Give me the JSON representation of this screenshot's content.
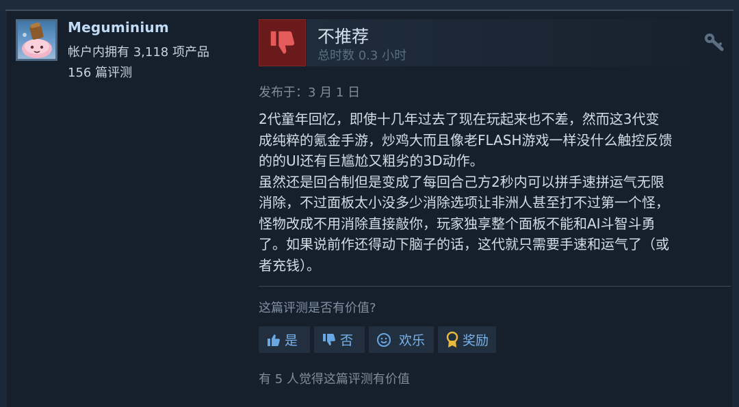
{
  "author": {
    "name": "Meguminium",
    "products_owned": "帐户内拥有 3,118 项产品",
    "reviews_count": "156 篇评测"
  },
  "review": {
    "verdict": "不推荐",
    "hours": "总时数 0.3 小时",
    "posted": "发布于：3 月 1 日",
    "paragraphs": [
      "2代童年回忆，即使十几年过去了现在玩起来也不差，然而这3代变",
      "成纯粹的氪金手游，炒鸡大而且像老FLASH游戏一样没什么触控反馈",
      "的的UI还有巨尴尬又粗劣的3D动作。",
      "虽然还是回合制但是变成了每回合己方2秒内可以拼手速拼运气无限",
      "消除，不过面板太小没多少消除选项让非洲人甚至打不过第一个怪，",
      "怪物改成不用消除直接敲你，玩家独享整个面板不能和AI斗智斗勇",
      "了。如果说前作还得动下脑子的话，这代就只需要手速和运气了（或",
      "者充钱）。"
    ]
  },
  "feedback": {
    "question": "这篇评测是否有价值?",
    "yes": "是",
    "no": "否",
    "funny": "欢乐",
    "award": "奖励",
    "helpful_summary": "有 5 人觉得这篇评测有价值"
  },
  "colors": {
    "background": "#1b2838",
    "card": "#16202d",
    "thumbs_down_bg": "#6a1a1a",
    "thumbs_down_icon": "#e35b5b",
    "link_blue": "#78b3ec",
    "award_gold": "#e8b93a"
  },
  "icons": {
    "verdict": "thumbs-down-icon",
    "key": "key-icon",
    "yes": "thumbs-up-icon",
    "no": "thumbs-down-icon",
    "funny": "smile-icon",
    "award": "award-icon"
  }
}
